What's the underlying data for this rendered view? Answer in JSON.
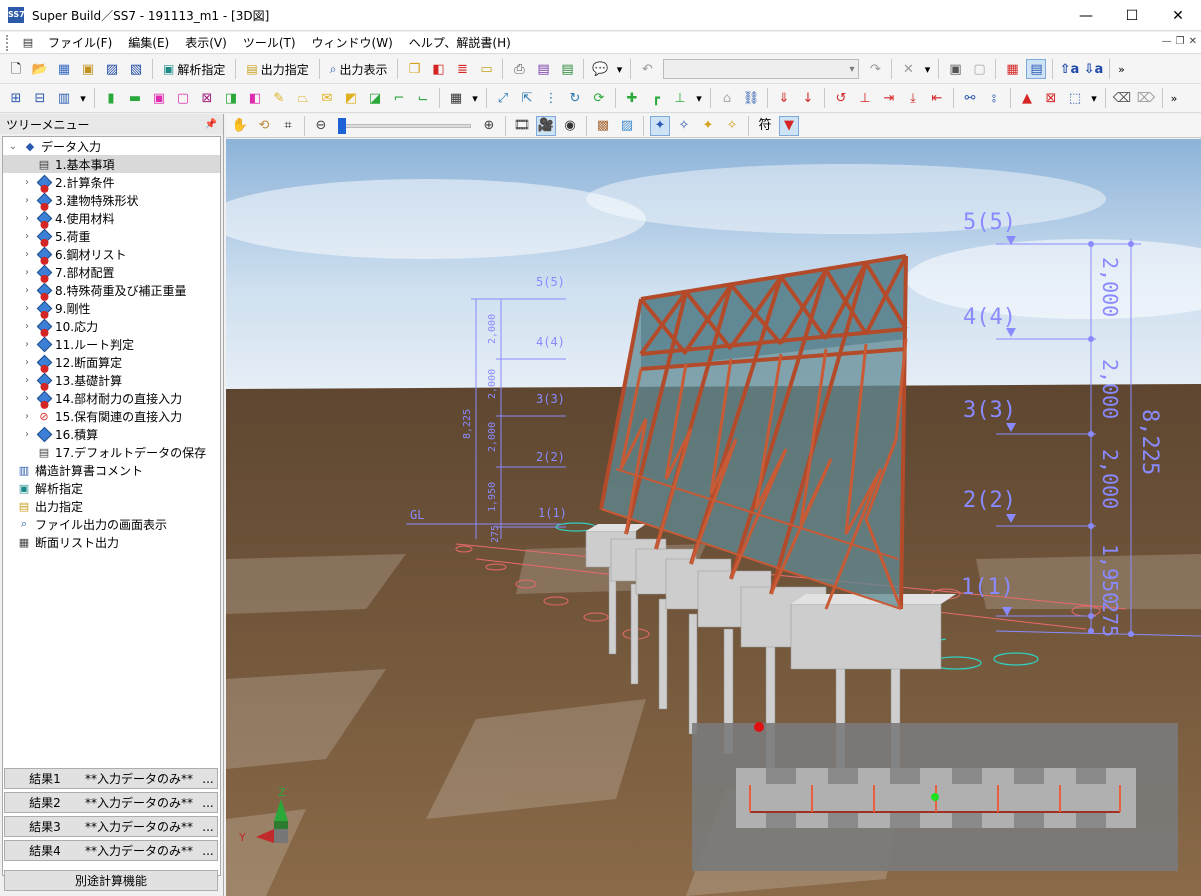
{
  "window": {
    "app_icon": "SS7",
    "title": "Super Build／SS7 - 191113_m1 - [3D図]",
    "controls": [
      "minimize-icon",
      "maximize-icon",
      "close-icon"
    ]
  },
  "menu": [
    "ファイル(F)",
    "編集(E)",
    "表示(V)",
    "ツール(T)",
    "ウィンドウ(W)",
    "ヘルプ、解説書(H)"
  ],
  "toolbar1": {
    "analysis": "解析指定",
    "output_spec": "出力指定",
    "output_display": "出力表示"
  },
  "panel": {
    "title": "ツリーメニュー",
    "pin": "ᵖ"
  },
  "tree": {
    "root": "データ入力",
    "items": [
      "1.基本事項",
      "2.計算条件",
      "3.建物特殊形状",
      "4.使用材料",
      "5.荷重",
      "6.鋼材リスト",
      "7.部材配置",
      "8.特殊荷重及び補正重量",
      "9.剛性",
      "10.応力",
      "11.ルート判定",
      "12.断面算定",
      "13.基礎計算",
      "14.部材耐力の直接入力",
      "15.保有関連の直接入力",
      "16.積算",
      "17.デフォルトデータの保存"
    ],
    "extras": [
      "構造計算書コメント",
      "解析指定",
      "出力指定",
      "ファイル出力の画面表示",
      "断面リスト出力"
    ]
  },
  "results": [
    {
      "label": "結果1",
      "value": "**入力データのみ**",
      "more": "..."
    },
    {
      "label": "結果2",
      "value": "**入力データのみ**",
      "more": "..."
    },
    {
      "label": "結果3",
      "value": "**入力データのみ**",
      "more": "..."
    },
    {
      "label": "結果4",
      "value": "**入力データのみ**",
      "more": "..."
    }
  ],
  "separate_calc": "別途計算機能",
  "viewtoolbar": {
    "symbol_label": "符",
    "zoom_level": 0
  },
  "scene": {
    "left_dims": {
      "levels": [
        "5(5)",
        "4(4)",
        "3(3)",
        "2(2)",
        "1(1)"
      ],
      "gl": "GL",
      "spans": [
        "2,000",
        "2,000",
        "2,000",
        "1,950",
        "275"
      ],
      "total": "8,225"
    },
    "right_dims": {
      "levels": [
        "5(5)",
        "4(4)",
        "3(3)",
        "2(2)",
        "1(1)"
      ],
      "spans": [
        "2,000",
        "2,000",
        "2,000",
        "1,950",
        "275"
      ],
      "total": "8,225"
    },
    "axes": {
      "z": "Z",
      "y": "Y"
    }
  },
  "colors": {
    "sky": "#9fbfe0",
    "ground": "#7a5a3a",
    "steel": "#b34a2a",
    "glass": "#5f8a94",
    "concrete": "#c9c9c9",
    "dim": "#7f7fff"
  }
}
